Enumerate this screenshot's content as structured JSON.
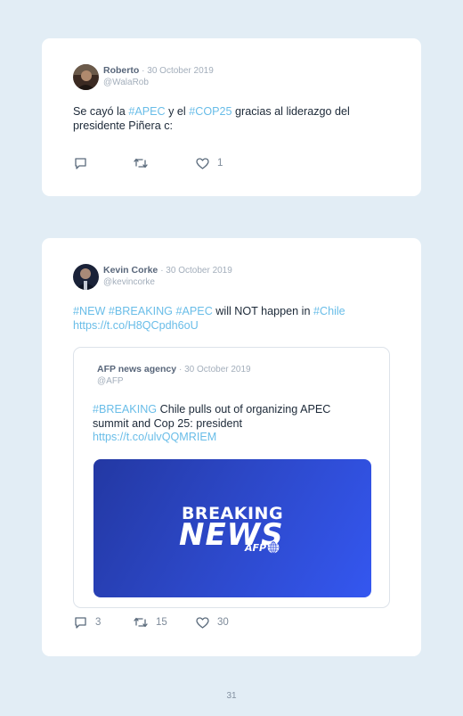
{
  "tweets": [
    {
      "author_name": "Roberto",
      "date": "· 30 October 2019",
      "handle": "@WalaRob",
      "text_parts": [
        {
          "text": "Se cayó la ",
          "link": false
        },
        {
          "text": "#APEC",
          "link": true
        },
        {
          "text": " y el ",
          "link": false
        },
        {
          "text": "#COP25",
          "link": true
        },
        {
          "text": " gracias al liderazgo del presidente Piñera c:",
          "link": false
        }
      ],
      "actions": {
        "reply_count": "",
        "retweet_count": "",
        "like_count": "1"
      }
    },
    {
      "author_name": "Kevin Corke",
      "date": "· 30 October 2019",
      "handle": "@kevincorke",
      "text_parts": [
        {
          "text": "#NEW",
          "link": true
        },
        {
          "text": " ",
          "link": false
        },
        {
          "text": "#BREAKING",
          "link": true
        },
        {
          "text": " ",
          "link": false
        },
        {
          "text": "#APEC",
          "link": true
        },
        {
          "text": " will NOT happen in ",
          "link": false
        },
        {
          "text": "#Chile",
          "link": true
        },
        {
          "text": " ",
          "link": false
        },
        {
          "text": "https://t.co/H8QCpdh6oU",
          "link": true
        }
      ],
      "quoted": {
        "author_name": "AFP news agency",
        "date": "· 30 October 2019",
        "handle": "@AFP",
        "text_parts": [
          {
            "text": "#BREAKING",
            "link": true
          },
          {
            "text": " Chile pulls out of organizing APEC summit and Cop 25: president ",
            "link": false
          },
          {
            "text": "https://t.co/ulvQQMRIEM",
            "link": true
          }
        ],
        "media": {
          "line1": "BREAKING",
          "line2": "NEWS",
          "logo_text": "AFP"
        }
      },
      "actions": {
        "reply_count": "3",
        "retweet_count": "15",
        "like_count": "30"
      }
    }
  ],
  "page_number": "31",
  "colors": {
    "link": "#69bde8",
    "background": "#e2edf5",
    "card": "#ffffff",
    "media_blue": "#2c47c6"
  },
  "icons": [
    "reply-icon",
    "retweet-icon",
    "like-icon"
  ]
}
